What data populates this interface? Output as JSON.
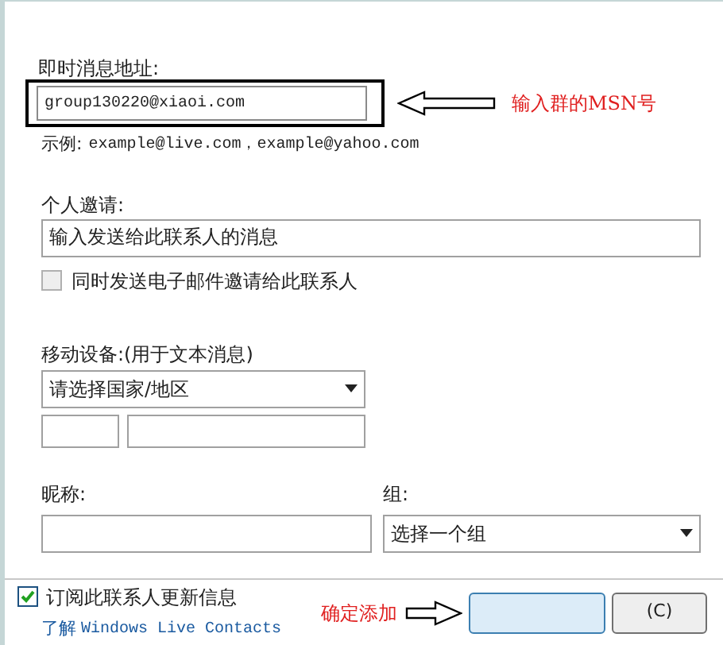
{
  "im_address": {
    "label": "即时消息地址:",
    "value": "group130220@xiaoi.com",
    "example_label": "示例:",
    "example": "example@live.com，example@yahoo.com"
  },
  "annotations": [
    {
      "kind": "field-arrow",
      "text": "输入群的MSN号"
    },
    {
      "kind": "button-arrow",
      "text": "确定添加"
    }
  ],
  "invitation": {
    "label": "个人邀请:",
    "value": "输入发送给此联系人的消息",
    "checkbox": {
      "label": "同时发送电子邮件邀请给此联系人",
      "checked": false
    }
  },
  "mobile": {
    "label": "移动设备:(用于文本消息)",
    "country": "请选择国家/地区"
  },
  "nickname": {
    "label": "昵称:"
  },
  "group": {
    "label": "组:",
    "value": "选择一个组"
  },
  "footer": {
    "subscribe": {
      "label": "订阅此联系人更新信息",
      "checked": true
    },
    "link_prefix": "了解",
    "link": "Windows Live Contacts",
    "buttons": [
      {
        "kind": "primary"
      },
      {
        "kind": "cancel",
        "label": "(C)"
      }
    ]
  }
}
